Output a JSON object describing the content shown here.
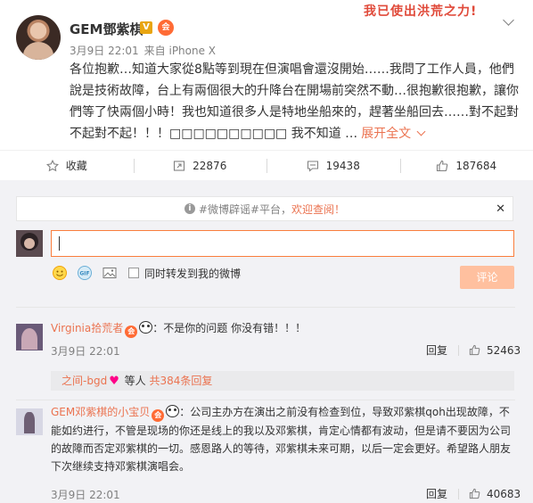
{
  "banner": "我已使出洪荒之力!",
  "post": {
    "username": "GEM鄧紫棋",
    "v_badge": "V",
    "member_badge": "会",
    "time": "3月9日 22:01",
    "source": "来自 iPhone X",
    "text": "各位抱歉…知道大家從8點等到現在但演唱會還沒開始……我問了工作人員，他們說是技術故障，台上有兩個很大的升降台在開場前突然不動…很抱歉很抱歉，讓你們等了快兩個小時！我也知道很多人是特地坐船來的，趕著坐船回去……對不起對不起對不起！！！□□□□□□□□□□ 我不知道 …",
    "expand_label": "展开全文"
  },
  "actions": {
    "favorite": "收藏",
    "repost": "22876",
    "comment": "19438",
    "like": "187684"
  },
  "notice": {
    "prefix": "#微博辟谣#平台，",
    "link": "欢迎查阅！",
    "close": "✕"
  },
  "composer": {
    "value": "",
    "repost_checkbox_label": "同时转发到我的微博",
    "submit_label": "评论"
  },
  "comments": [
    {
      "username": "Virginia拾荒者",
      "text": "：不是你的问题 你没有错！！！",
      "time": "3月9日 22:01",
      "reply_label": "回复",
      "likes": "52463"
    },
    {
      "username": "GEM邓紫棋的小宝贝",
      "text": "：公司主办方在演出之前没有检查到位，导致邓紫棋qoh出现故障，不能如约进行，不管是现场的你还是线上的我以及邓紫棋，肯定心情都有波动，但是请不要因为公司的故障而否定邓紫棋的一切。感恩路人的等待，邓紫棋未来可期，以后一定会更好。希望路人朋友下次继续支持邓紫棋演唱会。",
      "time": "3月9日 22:01",
      "reply_label": "回复",
      "likes": "40683"
    }
  ],
  "reply_summary": {
    "user": "之间-bgd",
    "middle": " 等人 ",
    "link": "共384条回复"
  },
  "colors": {
    "accent": "#eb7350",
    "input_border": "#fa7d3c",
    "submit_bg": "#ffc09f",
    "comment_area_bg": "#f2f2f5"
  },
  "icons": [
    "star-icon",
    "repost-icon",
    "comment-icon",
    "thumbs-up-icon",
    "emoji-icon",
    "gif-icon",
    "image-icon",
    "info-icon",
    "close-icon",
    "chevron-down-icon"
  ]
}
